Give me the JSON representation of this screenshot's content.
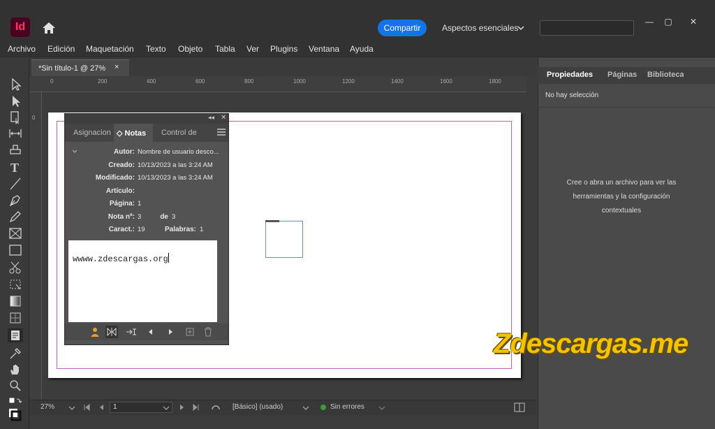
{
  "app": {
    "logo_text": "Id"
  },
  "header": {
    "share_label": "Compartir",
    "workspace_label": "Aspectos esenciales",
    "window_controls": [
      "—",
      "▢",
      "✕"
    ]
  },
  "menu": [
    "Archivo",
    "Edición",
    "Maquetación",
    "Texto",
    "Objeto",
    "Tabla",
    "Ver",
    "Plugins",
    "Ventana",
    "Ayuda"
  ],
  "document": {
    "tab_title": "*Sin título-1 @ 27%",
    "tab_close": "×",
    "ruler_ticks": [
      "0",
      "200",
      "400",
      "600",
      "800",
      "1000",
      "1200",
      "1400",
      "1600",
      "1800"
    ],
    "left_ruler_tick": "0"
  },
  "notes_panel": {
    "collapse": "◂◂",
    "close": "✕",
    "tabs": [
      "Asignacion",
      "◇ Notas",
      "Control de"
    ],
    "fields": {
      "author_label": "Autor:",
      "author_value": "Nombre de usuario desco...",
      "created_label": "Creado:",
      "created_value": "10/13/2023 a las 3:24 AM",
      "modified_label": "Modificado:",
      "modified_value": "10/13/2023 a las 3:24 AM",
      "article_label": "Artículo:",
      "page_label": "Página:",
      "page_value": "1",
      "note_label": "Nota nº:",
      "note_value": "3",
      "of_label": "de",
      "of_value": "3",
      "chars_label": "Caract.:",
      "chars_value": "19",
      "words_label": "Palabras:",
      "words_value": "1"
    },
    "note_text": "wwww.zdescargas.org"
  },
  "right_panel": {
    "tabs": [
      "Propiedades",
      "Páginas",
      "Bibliotecas"
    ],
    "no_selection": "No hay selección",
    "message": "Cree o abra un archivo para ver las herramientas y la configuración contextuales"
  },
  "status": {
    "zoom": "27%",
    "page": "1",
    "style": "[Básico] (usado)",
    "errors": "Sin errores"
  },
  "watermark": "Zdescargas.me",
  "colors": {
    "accent": "#1473e6",
    "margin_guide": "#c060c0",
    "frame": "#6d8fb5",
    "watermark": "#f2c400"
  }
}
